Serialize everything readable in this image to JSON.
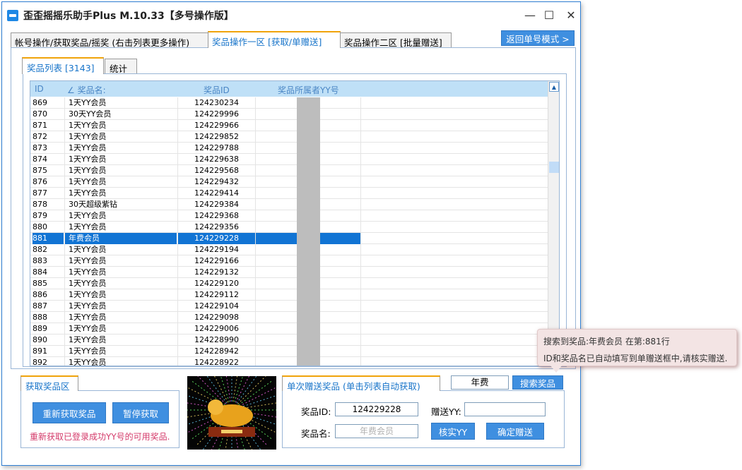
{
  "window": {
    "title": "歪歪摇摇乐助手Plus M.10.33【多号操作版】",
    "minimize_icon": "minimize-icon",
    "maximize_icon": "maximize-icon",
    "close_icon": "close-icon"
  },
  "tabs": [
    {
      "label": "帐号操作/获取奖品/摇奖 (右击列表更多操作)"
    },
    {
      "label": "奖品操作一区 [获取/单赠送]"
    },
    {
      "label": "奖品操作二区 [批量赠送]"
    }
  ],
  "return_button": "返回单号模式 >",
  "subtabs": [
    {
      "label": "奖品列表 [3143]"
    },
    {
      "label": "统计"
    }
  ],
  "list": {
    "columns": [
      "ID",
      "∠ 奖品名:",
      "奖品ID",
      "奖品所属者YY号"
    ],
    "rows": [
      {
        "id": "869",
        "name": "1天YY会员",
        "prize_id": "124230234"
      },
      {
        "id": "870",
        "name": "30天YY会员",
        "prize_id": "124229996"
      },
      {
        "id": "871",
        "name": "1天YY会员",
        "prize_id": "124229966"
      },
      {
        "id": "872",
        "name": "1天YY会员",
        "prize_id": "124229852"
      },
      {
        "id": "873",
        "name": "1天YY会员",
        "prize_id": "124229788"
      },
      {
        "id": "874",
        "name": "1天YY会员",
        "prize_id": "124229638"
      },
      {
        "id": "875",
        "name": "1天YY会员",
        "prize_id": "124229568"
      },
      {
        "id": "876",
        "name": "1天YY会员",
        "prize_id": "124229432"
      },
      {
        "id": "877",
        "name": "1天YY会员",
        "prize_id": "124229414"
      },
      {
        "id": "878",
        "name": "30天超级紫钻",
        "prize_id": "124229384"
      },
      {
        "id": "879",
        "name": "1天YY会员",
        "prize_id": "124229368"
      },
      {
        "id": "880",
        "name": "1天YY会员",
        "prize_id": "124229356"
      },
      {
        "id": "881",
        "name": "年费会员",
        "prize_id": "124229228",
        "selected": true
      },
      {
        "id": "882",
        "name": "1天YY会员",
        "prize_id": "124229194"
      },
      {
        "id": "883",
        "name": "1天YY会员",
        "prize_id": "124229166"
      },
      {
        "id": "884",
        "name": "1天YY会员",
        "prize_id": "124229132"
      },
      {
        "id": "885",
        "name": "1天YY会员",
        "prize_id": "124229120"
      },
      {
        "id": "886",
        "name": "1天YY会员",
        "prize_id": "124229112"
      },
      {
        "id": "887",
        "name": "1天YY会员",
        "prize_id": "124229104"
      },
      {
        "id": "888",
        "name": "1天YY会员",
        "prize_id": "124229098"
      },
      {
        "id": "889",
        "name": "1天YY会员",
        "prize_id": "124229006"
      },
      {
        "id": "890",
        "name": "1天YY会员",
        "prize_id": "124228990"
      },
      {
        "id": "891",
        "name": "1天YY会员",
        "prize_id": "124228942"
      },
      {
        "id": "892",
        "name": "1天YY会员",
        "prize_id": "124228922"
      }
    ]
  },
  "fetch_group": {
    "title": "获取奖品区",
    "refetch_button": "重新获取奖品",
    "pause_button": "暂停获取",
    "note": "重新获取已登录成功YY号的可用奖品."
  },
  "single_give_group": {
    "title": "单次赠送奖品 (单击列表自动获取)",
    "prize_id_label": "奖品ID:",
    "prize_id_value": "124229228",
    "give_yy_label": "赠送YY:",
    "give_yy_value": "",
    "prize_name_label": "奖品名:",
    "prize_name_placeholder": "年费会员",
    "verify_button": "核实YY",
    "confirm_button": "确定赠送"
  },
  "search": {
    "value": "年费",
    "button": "搜索奖品"
  },
  "tooltip": {
    "line1": "搜索到奖品:年费会员 在第:881行",
    "line2": "ID和奖品名已自动填写到单赠送框中,请核实赠送."
  },
  "colors": {
    "accent_blue": "#3f8fe0",
    "selection_blue": "#1174d4",
    "tab_orange": "#f0a30a",
    "note_red": "#d43a6a"
  }
}
